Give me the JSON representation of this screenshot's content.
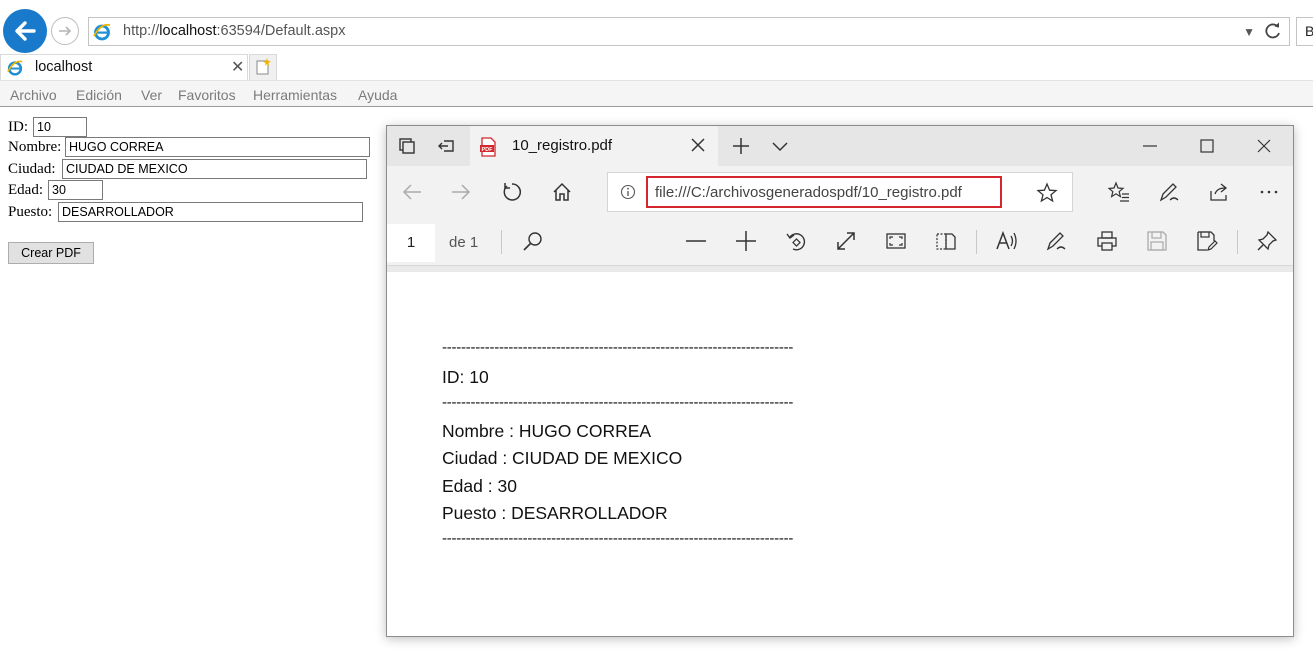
{
  "browser": {
    "url_prefix": "http://",
    "url_host": "localhost",
    "url_rest": ":63594/Default.aspx",
    "search_edge_text": "B",
    "tab_title": "localhost",
    "menu": [
      "Archivo",
      "Edición",
      "Ver",
      "Favoritos",
      "Herramientas",
      "Ayuda"
    ]
  },
  "form": {
    "id_label": "ID:",
    "id_value": "10",
    "nombre_label": "Nombre:",
    "nombre_value": "HUGO CORREA",
    "ciudad_label": "Ciudad:",
    "ciudad_value": "CIUDAD DE MEXICO",
    "edad_label": "Edad:",
    "edad_value": "30",
    "puesto_label": "Puesto:",
    "puesto_value": "DESARROLLADOR",
    "button_label": "Crear PDF"
  },
  "edge": {
    "tab_title": "10_registro.pdf",
    "url": "file:///C:/archivosgeneradospdf/10_registro.pdf",
    "page_number": "1",
    "page_of": "de 1",
    "highlight_color": "#d4262d"
  },
  "pdf": {
    "separator": "--------------------------------------------------------------------------",
    "id_line": "ID: 10",
    "nombre_line": "Nombre : HUGO CORREA",
    "ciudad_line": "Ciudad : CIUDAD DE MEXICO",
    "edad_line": "Edad : 30",
    "puesto_line": "Puesto : DESARROLLADOR"
  }
}
